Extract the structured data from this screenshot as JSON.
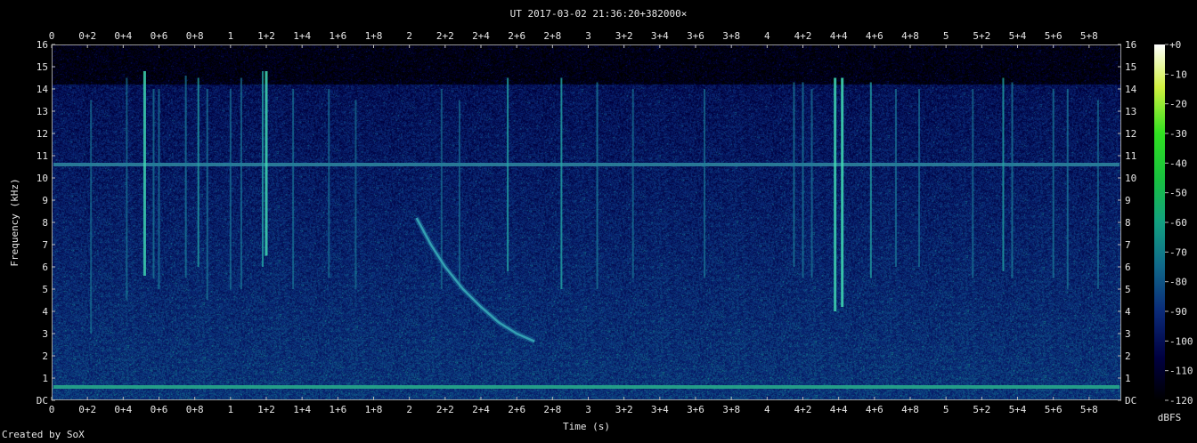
{
  "chart_data": {
    "type": "heatmap",
    "title": "UT 2017-03-02 21:36:20+382000×",
    "xlabel": "Time (s)",
    "ylabel": "Frequency (kHz)",
    "xlim": [
      0,
      5.98
    ],
    "ylim": [
      0,
      16
    ],
    "x_ticks": [
      "0",
      "0+2",
      "0+4",
      "0+6",
      "0+8",
      "1",
      "1+2",
      "1+4",
      "1+6",
      "1+8",
      "2",
      "2+2",
      "2+4",
      "2+6",
      "2+8",
      "3",
      "3+2",
      "3+4",
      "3+6",
      "3+8",
      "4",
      "4+2",
      "4+4",
      "4+6",
      "4+8",
      "5",
      "5+2",
      "5+4",
      "5+6",
      "5+8"
    ],
    "y_ticks": [
      "DC",
      "1",
      "2",
      "3",
      "4",
      "5",
      "6",
      "7",
      "8",
      "9",
      "10",
      "11",
      "12",
      "13",
      "14",
      "15",
      "16"
    ],
    "colorbar": {
      "label": "dBFS",
      "ticks": [
        "+0",
        "-10",
        "-20",
        "-30",
        "-40",
        "-50",
        "-60",
        "-70",
        "-80",
        "-90",
        "-100",
        "-110",
        "-120"
      ],
      "range": [
        -120,
        0
      ]
    },
    "grid": false,
    "features": {
      "tone_band_khz": 10.6,
      "low_band_khz": 0.6,
      "whistler": [
        {
          "t": 2.04,
          "f": 8.2
        },
        {
          "t": 2.12,
          "f": 7.0
        },
        {
          "t": 2.2,
          "f": 6.0
        },
        {
          "t": 2.3,
          "f": 5.0
        },
        {
          "t": 2.4,
          "f": 4.2
        },
        {
          "t": 2.5,
          "f": 3.5
        },
        {
          "t": 2.6,
          "f": 3.0
        },
        {
          "t": 2.7,
          "f": 2.65
        }
      ],
      "impulses": [
        {
          "t": 0.22,
          "f_low": 3.0,
          "f_high": 13.5,
          "strength": 0.3
        },
        {
          "t": 0.42,
          "f_low": 4.5,
          "f_high": 14.5,
          "strength": 0.35
        },
        {
          "t": 0.52,
          "f_low": 5.6,
          "f_high": 14.8,
          "strength": 0.8
        },
        {
          "t": 0.57,
          "f_low": 5.5,
          "f_high": 14.0,
          "strength": 0.5
        },
        {
          "t": 0.6,
          "f_low": 5.0,
          "f_high": 14.0,
          "strength": 0.45
        },
        {
          "t": 0.75,
          "f_low": 5.5,
          "f_high": 14.6,
          "strength": 0.5
        },
        {
          "t": 0.82,
          "f_low": 6.0,
          "f_high": 14.5,
          "strength": 0.6
        },
        {
          "t": 0.87,
          "f_low": 4.5,
          "f_high": 14.0,
          "strength": 0.4
        },
        {
          "t": 1.0,
          "f_low": 5.0,
          "f_high": 14.0,
          "strength": 0.4
        },
        {
          "t": 1.06,
          "f_low": 5.0,
          "f_high": 14.5,
          "strength": 0.45
        },
        {
          "t": 1.18,
          "f_low": 6.0,
          "f_high": 14.8,
          "strength": 0.7
        },
        {
          "t": 1.2,
          "f_low": 6.5,
          "f_high": 14.8,
          "strength": 0.85
        },
        {
          "t": 1.35,
          "f_low": 5.0,
          "f_high": 14.0,
          "strength": 0.35
        },
        {
          "t": 1.55,
          "f_low": 5.5,
          "f_high": 14.0,
          "strength": 0.35
        },
        {
          "t": 1.7,
          "f_low": 5.0,
          "f_high": 13.5,
          "strength": 0.3
        },
        {
          "t": 2.18,
          "f_low": 5.0,
          "f_high": 14.0,
          "strength": 0.3
        },
        {
          "t": 2.28,
          "f_low": 5.0,
          "f_high": 13.5,
          "strength": 0.3
        },
        {
          "t": 2.55,
          "f_low": 5.8,
          "f_high": 14.5,
          "strength": 0.7
        },
        {
          "t": 2.85,
          "f_low": 5.0,
          "f_high": 14.5,
          "strength": 0.7
        },
        {
          "t": 3.05,
          "f_low": 5.0,
          "f_high": 14.3,
          "strength": 0.5
        },
        {
          "t": 3.25,
          "f_low": 5.5,
          "f_high": 14.0,
          "strength": 0.35
        },
        {
          "t": 3.65,
          "f_low": 5.5,
          "f_high": 14.0,
          "strength": 0.35
        },
        {
          "t": 4.15,
          "f_low": 6.0,
          "f_high": 14.3,
          "strength": 0.5
        },
        {
          "t": 4.2,
          "f_low": 5.5,
          "f_high": 14.3,
          "strength": 0.5
        },
        {
          "t": 4.25,
          "f_low": 5.5,
          "f_high": 14.0,
          "strength": 0.4
        },
        {
          "t": 4.38,
          "f_low": 4.0,
          "f_high": 14.5,
          "strength": 0.85
        },
        {
          "t": 4.42,
          "f_low": 4.2,
          "f_high": 14.5,
          "strength": 0.9
        },
        {
          "t": 4.58,
          "f_low": 5.5,
          "f_high": 14.3,
          "strength": 0.6
        },
        {
          "t": 4.72,
          "f_low": 6.0,
          "f_high": 14.0,
          "strength": 0.4
        },
        {
          "t": 4.85,
          "f_low": 6.0,
          "f_high": 14.0,
          "strength": 0.35
        },
        {
          "t": 5.15,
          "f_low": 5.5,
          "f_high": 14.0,
          "strength": 0.35
        },
        {
          "t": 5.32,
          "f_low": 5.8,
          "f_high": 14.5,
          "strength": 0.65
        },
        {
          "t": 5.37,
          "f_low": 5.5,
          "f_high": 14.3,
          "strength": 0.5
        },
        {
          "t": 5.6,
          "f_low": 5.5,
          "f_high": 14.0,
          "strength": 0.5
        },
        {
          "t": 5.68,
          "f_low": 5.0,
          "f_high": 14.0,
          "strength": 0.45
        },
        {
          "t": 5.85,
          "f_low": 5.0,
          "f_high": 13.5,
          "strength": 0.3
        }
      ]
    }
  },
  "footer": {
    "credit": "Created by SoX"
  }
}
